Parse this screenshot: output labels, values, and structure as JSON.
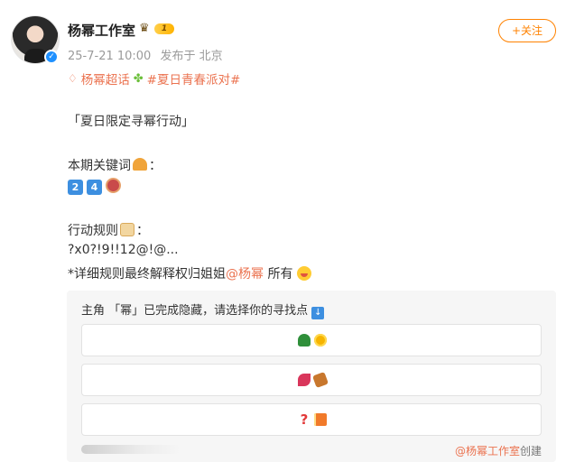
{
  "author": {
    "name": "杨幂工作室",
    "level": "1",
    "verified_mark": "✓"
  },
  "meta": {
    "time": "25-7-21 10:00",
    "location": "发布于 北京"
  },
  "follow": {
    "label": "+关注"
  },
  "topics": {
    "super_topic": "杨幂超话",
    "hashtag": "#夏日青春派对#"
  },
  "body": {
    "headline": "「夏日限定寻幂行动」",
    "keyword_label": "本期关键词",
    "keyword_colon": "：",
    "key_digits": [
      "2",
      "4"
    ],
    "rules_label": "行动规则",
    "rules_colon": "：",
    "code_line": "?x0?!9!!12@!@...",
    "note_prefix": "*详细规则最终解释权归姐姐",
    "note_mention": "@杨幂",
    "note_suffix": " 所有"
  },
  "vote": {
    "title": "主角 「幂」已完成隐藏，请选择你的寻找点",
    "down_arrow": "↓",
    "options": [
      "tree-sun",
      "leaf-log",
      "question-gift"
    ],
    "creator_mention": "@杨幂工作室",
    "creator_suffix": "创建"
  },
  "colors": {
    "accent": "#eb7350",
    "follow": "#ff8200",
    "verified": "#1e90ff"
  }
}
